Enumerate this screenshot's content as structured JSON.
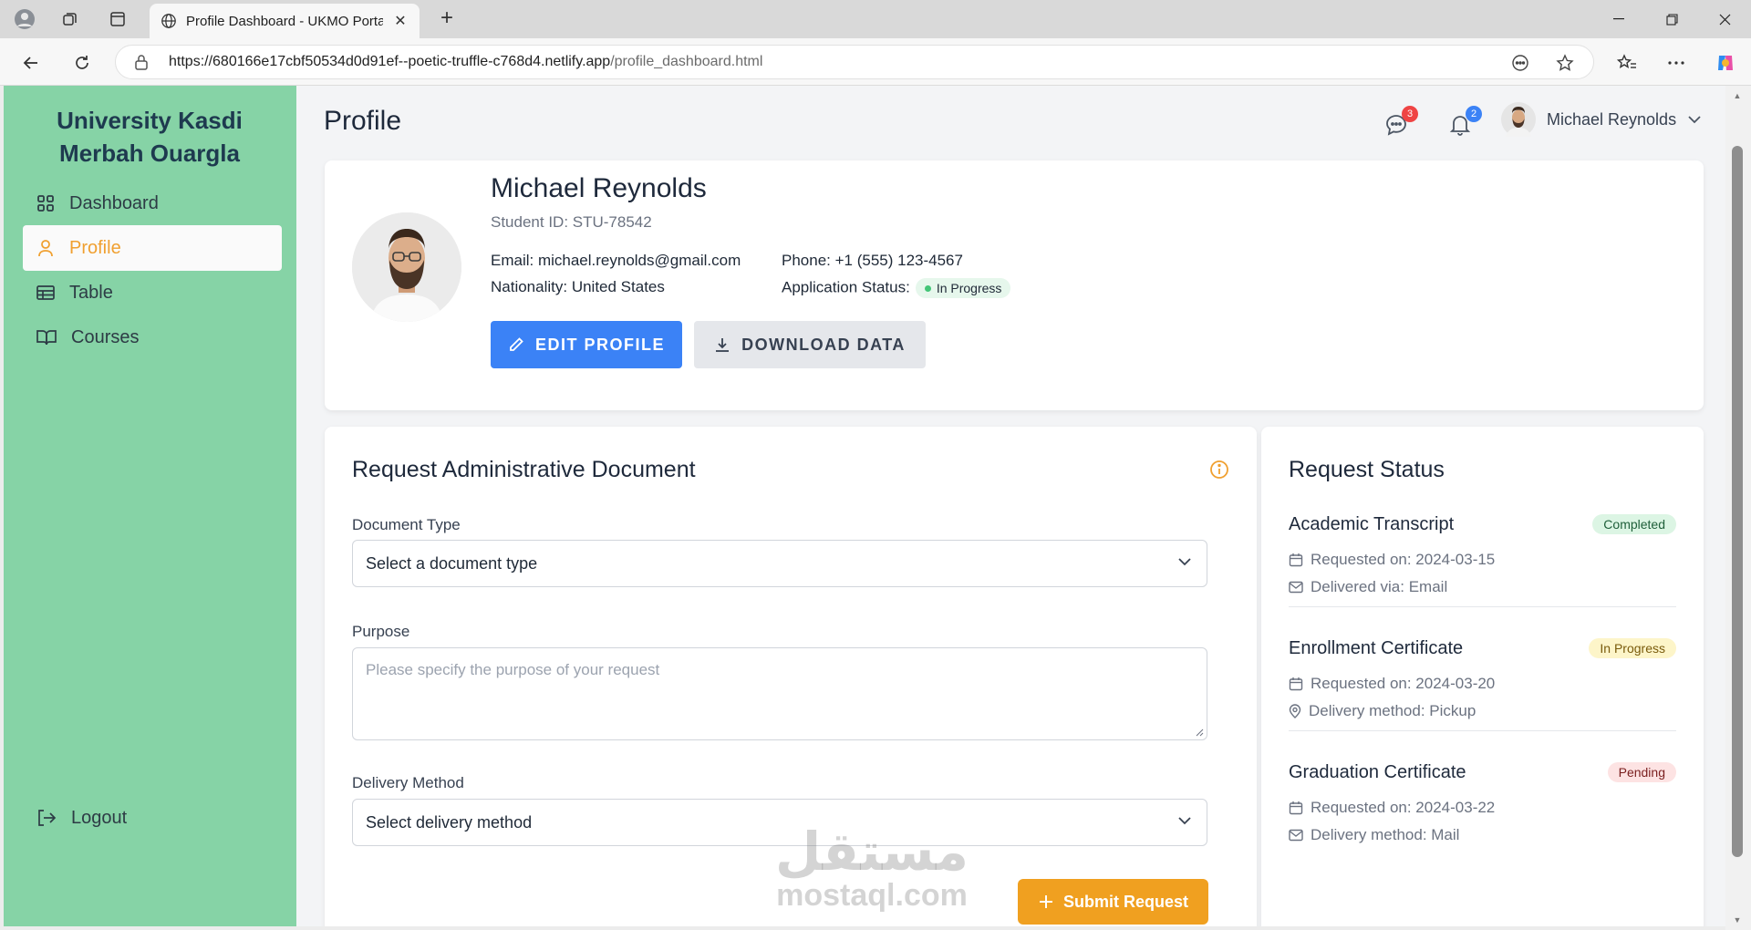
{
  "browser": {
    "tab_title": "Profile Dashboard - UKMO Portal",
    "url_main": "https://680166e17cbf50534d0d91ef--poetic-truffle-c768d4.netlify.app",
    "url_path": "/profile_dashboard.html"
  },
  "sidebar": {
    "brand": "University Kasdi Merbah Ouargla",
    "items": [
      {
        "label": "Dashboard",
        "icon": "grid-icon"
      },
      {
        "label": "Profile",
        "icon": "user-icon"
      },
      {
        "label": "Table",
        "icon": "table-icon"
      },
      {
        "label": "Courses",
        "icon": "book-icon"
      }
    ],
    "logout": "Logout",
    "color": "#86d3a6",
    "accent": "#f0a030"
  },
  "header": {
    "title": "Profile",
    "messages_count": "3",
    "notifications_count": "2",
    "user_name": "Michael Reynolds"
  },
  "profile": {
    "name": "Michael Reynolds",
    "student_id": "Student ID: STU-78542",
    "email": "Email: michael.reynolds@gmail.com",
    "phone": "Phone: +1 (555) 123-4567",
    "nationality": "Nationality: United States",
    "status_label": "Application Status:",
    "status_value": "In Progress",
    "edit_button": "EDIT PROFILE",
    "download_button": "DOWNLOAD DATA"
  },
  "request_form": {
    "title": "Request Administrative Document",
    "doc_type_label": "Document Type",
    "doc_type_value": "Select a document type",
    "purpose_label": "Purpose",
    "purpose_placeholder": "Please specify the purpose of your request",
    "delivery_label": "Delivery Method",
    "delivery_value": "Select delivery method",
    "submit": "Submit Request"
  },
  "request_status": {
    "title": "Request Status",
    "items": [
      {
        "title": "Academic Transcript",
        "status": "Completed",
        "requested": "Requested on: 2024-03-15",
        "delivery": "Delivered via: Email",
        "delivery_icon": "mail-icon"
      },
      {
        "title": "Enrollment Certificate",
        "status": "In Progress",
        "requested": "Requested on: 2024-03-20",
        "delivery": "Delivery method: Pickup",
        "delivery_icon": "location-icon"
      },
      {
        "title": "Graduation Certificate",
        "status": "Pending",
        "requested": "Requested on: 2024-03-22",
        "delivery": "Delivery method: Mail",
        "delivery_icon": "mail-icon"
      }
    ]
  },
  "watermark": {
    "arabic": "مستقل",
    "latin": "mostaql.com"
  }
}
